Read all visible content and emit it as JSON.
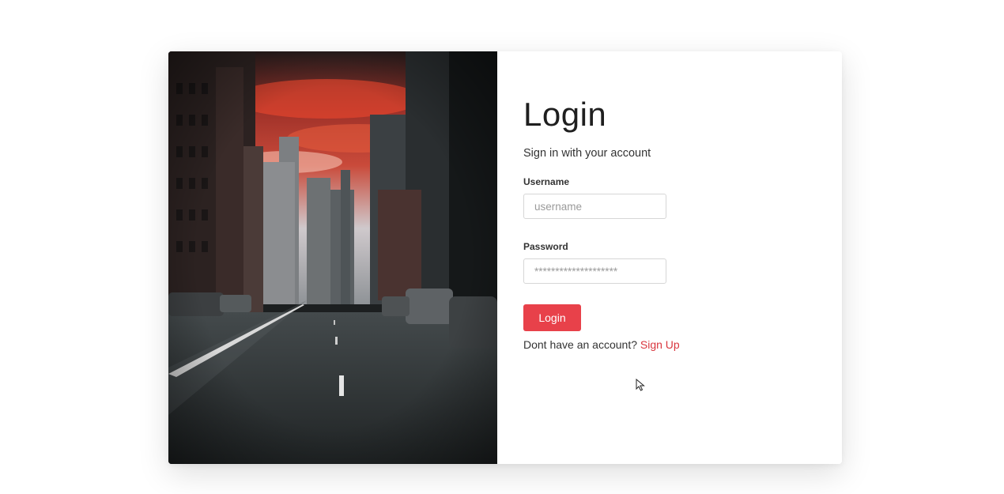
{
  "login": {
    "title": "Login",
    "subtitle": "Sign in with your account",
    "username_label": "Username",
    "username_placeholder": "username",
    "password_label": "Password",
    "password_placeholder": "********************",
    "submit_label": "Login",
    "signup_prompt": "Dont have an account?",
    "signup_link": "Sign Up"
  },
  "image": {
    "description_name": "city-street-photo"
  },
  "colors": {
    "accent": "#e8414a",
    "link": "#d9363e"
  }
}
